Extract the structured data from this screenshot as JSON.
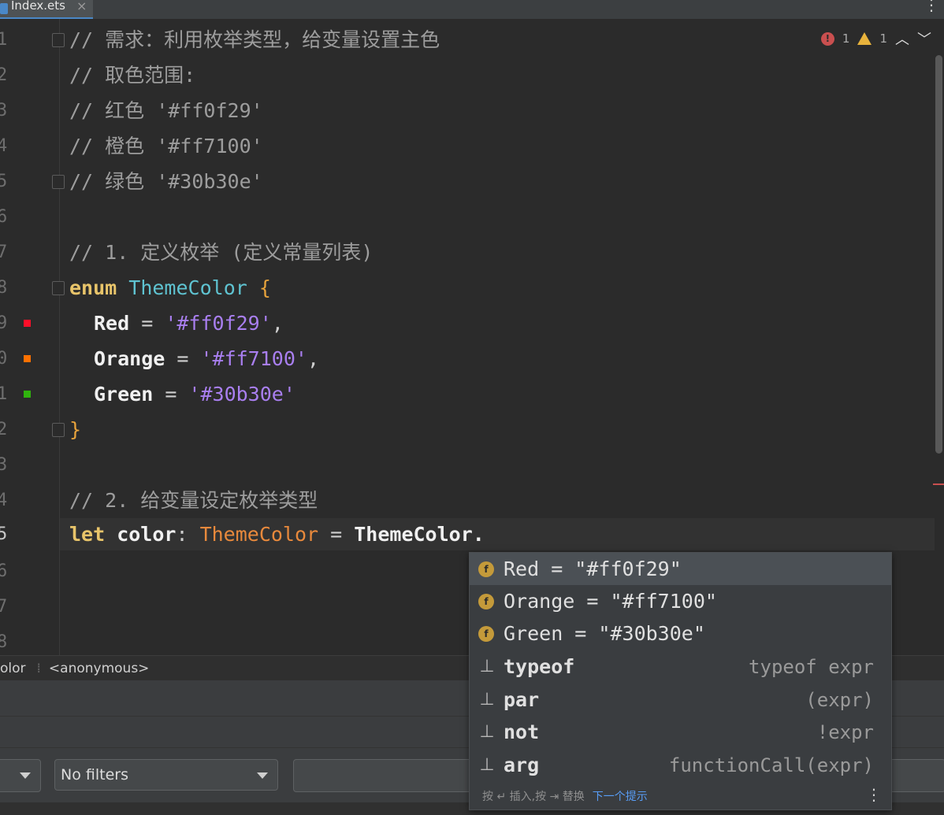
{
  "tab": {
    "label": "Index.ets",
    "close": "×"
  },
  "more_icon": "⋮",
  "inspections": {
    "errors": "1",
    "warnings": "1",
    "error_glyph": "!",
    "prev": "︿",
    "next": "﹀"
  },
  "lines": [
    {
      "num": "1",
      "comment": "// 需求：利用枚举类型，给变量设置主色"
    },
    {
      "num": "2",
      "comment": "// 取色范围:"
    },
    {
      "num": "3",
      "comment": "// 红色 '#ff0f29'"
    },
    {
      "num": "4",
      "comment": "// 橙色 '#ff7100'"
    },
    {
      "num": "5",
      "comment": "// 绿色 '#30b30e'"
    },
    {
      "num": "6"
    },
    {
      "num": "7",
      "comment": "// 1. 定义枚举 (定义常量列表)"
    },
    {
      "num": "8",
      "kw": "enum",
      "type": "ThemeColor",
      "brace": "{"
    },
    {
      "num": "9",
      "prop": "Red",
      "eq": " = ",
      "str": "'#ff0f29'",
      "comma": ","
    },
    {
      "num": "0",
      "prop": "Orange",
      "eq": " = ",
      "str": "'#ff7100'",
      "comma": ","
    },
    {
      "num": "1",
      "prop": "Green",
      "eq": " = ",
      "str": "'#30b30e'"
    },
    {
      "num": "2",
      "brace": "}"
    },
    {
      "num": "3"
    },
    {
      "num": "4",
      "comment": "// 2. 给变量设定枚举类型"
    },
    {
      "num": "5",
      "kw": "let",
      "var": " color",
      "colon": ": ",
      "type2": "ThemeColor",
      "eq": " = ",
      "expr": "ThemeColor."
    },
    {
      "num": "6"
    },
    {
      "num": "7"
    },
    {
      "num": "8"
    }
  ],
  "swatch_colors": {
    "red": "#ff0f29",
    "orange": "#ff7100",
    "green": "#30b30e"
  },
  "breadcrumb": {
    "item1": "olor",
    "item2": "<anonymous>"
  },
  "filters": {
    "value": "No filters"
  },
  "completion": {
    "items": [
      {
        "icon": "f",
        "label": "Red = \"#ff0f29\"",
        "hint": ""
      },
      {
        "icon": "f",
        "label": "Orange = \"#ff7100\"",
        "hint": ""
      },
      {
        "icon": "f",
        "label": "Green = \"#30b30e\"",
        "hint": ""
      },
      {
        "icon": "template",
        "label": "typeof",
        "hint": "typeof expr"
      },
      {
        "icon": "template",
        "label": "par",
        "hint": "(expr)"
      },
      {
        "icon": "template",
        "label": "not",
        "hint": "!expr"
      },
      {
        "icon": "template",
        "label": "arg",
        "hint": "functionCall(expr)"
      }
    ],
    "template_glyph": "⊥",
    "footer_text": "按 ↵ 插入,按 ⇥ 替换",
    "footer_link": "下一个提示",
    "footer_more": "⋮"
  }
}
